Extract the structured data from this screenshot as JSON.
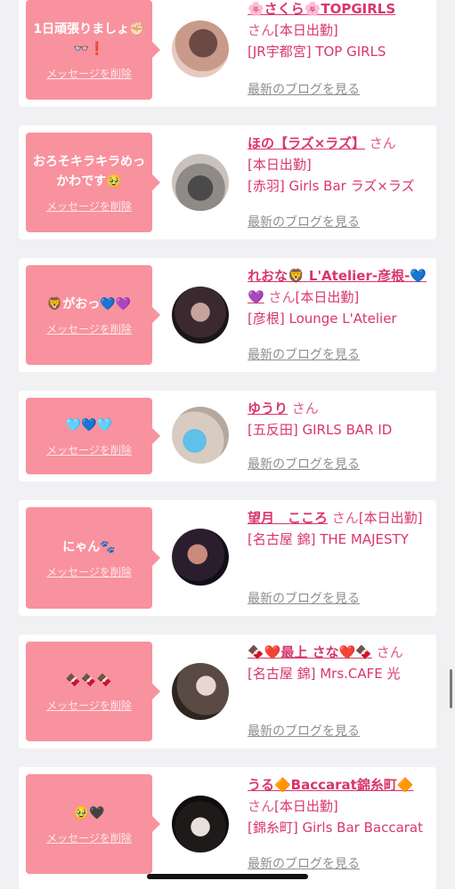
{
  "cards": [
    {
      "message": "1日頑張りましょ✊🏻👓❗️",
      "delete_label": "メッセージを削除",
      "name": "🌸さくら🌸TOPGIRLS",
      "san": "さん",
      "status": "[本日出勤]",
      "shop": "[JR宇都宮] TOP GIRLS",
      "blog": "最新のブログを見る",
      "avatar_colors": [
        "#c99a8a",
        "#6b4a44"
      ]
    },
    {
      "message": "おろそキラキラめっかわです🥹",
      "delete_label": "メッセージを削除",
      "name": "ほの【ラズ×ラズ】",
      "san": "さん",
      "status": "[本日出勤]",
      "shop": "[赤羽] Girls Bar ラズ×ラズ",
      "blog": "最新のブログを見る",
      "avatar_colors": [
        "#b8b0a8",
        "#4a4a4a"
      ]
    },
    {
      "message": "🦁がおっ💙💜",
      "delete_label": "メッセージを削除",
      "name": "れおな🦁 L'Atelier-彦根-💙💜",
      "san": "さん",
      "status": "[本日出勤]",
      "shop": "[彦根] Lounge L'Atelier",
      "blog": "最新のブログを見る",
      "avatar_colors": [
        "#3a2a30",
        "#c7a49b"
      ]
    },
    {
      "message": "🩵💙🩵",
      "delete_label": "メッセージを削除",
      "name": "ゆうり",
      "san": "さん",
      "status": "",
      "shop": "[五反田] GIRLS BAR ID",
      "blog": "最新のブログを見る",
      "avatar_colors": [
        "#d8ccc2",
        "#5fc0e8"
      ]
    },
    {
      "message": "にゃん🐾",
      "delete_label": "メッセージを削除",
      "name": "望月　こころ",
      "san": "さん",
      "status": "[本日出勤]",
      "shop": "[名古屋 錦] THE MAJESTY",
      "blog": "最新のブログを見る",
      "avatar_colors": [
        "#2a1e2e",
        "#c98a7c"
      ]
    },
    {
      "message": "🍫🍫🍫",
      "delete_label": "メッセージを削除",
      "name": "🍫❤️最上 さな❤️🍫",
      "san": "さん",
      "status": "",
      "shop": "[名古屋 錦] Mrs.CAFE 光",
      "blog": "最新のブログを見る",
      "avatar_colors": [
        "#5a4a44",
        "#e8d6d0"
      ]
    },
    {
      "message": "🥹🖤",
      "delete_label": "メッセージを削除",
      "name": "うる🔶Baccarat錦糸町🔶",
      "san": "さん",
      "status": "[本日出勤]",
      "shop": "[錦糸町] Girls Bar Baccarat",
      "blog": "最新のブログを見る",
      "avatar_colors": [
        "#1e1a1a",
        "#e6e0dc"
      ]
    }
  ]
}
